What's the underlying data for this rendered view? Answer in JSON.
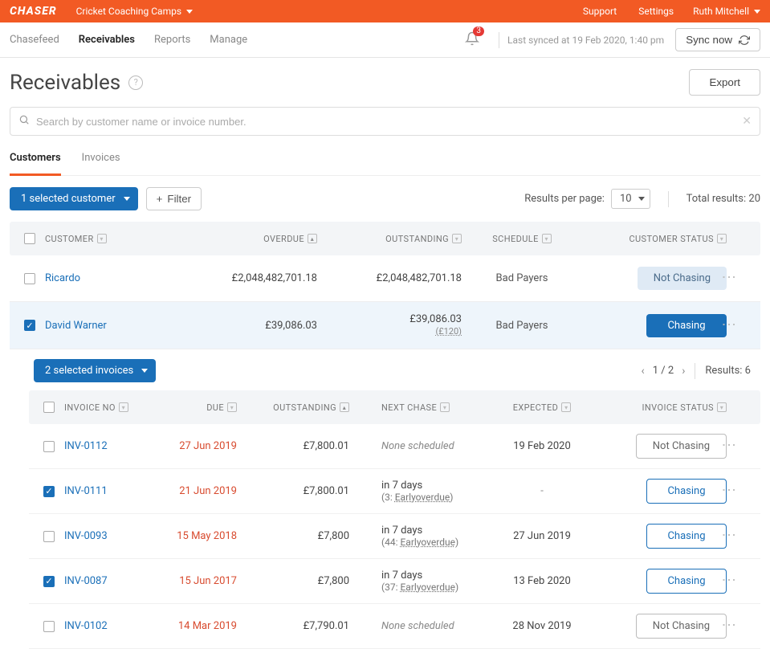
{
  "topbar": {
    "logo": "CHASER",
    "org": "Cricket Coaching Camps",
    "support": "Support",
    "settings": "Settings",
    "user": "Ruth Mitchell"
  },
  "nav": {
    "tabs": [
      "Chasefeed",
      "Receivables",
      "Reports",
      "Manage"
    ],
    "active": 1,
    "notif_count": "3",
    "last_synced": "Last synced at 19 Feb 2020, 1:40 pm",
    "sync_btn": "Sync now"
  },
  "page": {
    "title": "Receivables",
    "export": "Export",
    "search_placeholder": "Search by customer name or invoice number."
  },
  "subtabs": {
    "customers": "Customers",
    "invoices": "Invoices",
    "active": "customers"
  },
  "toolbar": {
    "selection": "1 selected customer",
    "filter": "Filter",
    "rpp_label": "Results per page:",
    "rpp_value": "10",
    "total_label": "Total results: 20"
  },
  "thead": {
    "customer": "CUSTOMER",
    "overdue": "OVERDUE",
    "outstanding": "OUTSTANDING",
    "schedule": "SCHEDULE",
    "status": "CUSTOMER STATUS"
  },
  "customers": [
    {
      "checked": false,
      "name": "Ricardo",
      "overdue": "£2,048,482,701.18",
      "outstanding": "£2,048,482,701.18",
      "credit": "",
      "schedule": "Bad Payers",
      "status": "Not Chasing",
      "status_style": "chip-notchasing-soft"
    },
    {
      "checked": true,
      "name": "David Warner",
      "overdue": "£39,086.03",
      "outstanding": "£39,086.03",
      "credit": "(£120)",
      "schedule": "Bad Payers",
      "status": "Chasing",
      "status_style": "chip-chasing-primary"
    }
  ],
  "inv_toolbar": {
    "selection": "2 selected invoices",
    "page": "1 / 2",
    "results": "Results: 6"
  },
  "ihead": {
    "no": "INVOICE NO",
    "due": "DUE",
    "outstanding": "OUTSTANDING",
    "next": "NEXT CHASE",
    "expected": "EXPECTED",
    "status": "INVOICE STATUS"
  },
  "invoices": [
    {
      "checked": false,
      "no": "INV-0112",
      "due": "27 Jun 2019",
      "outstanding": "£7,800.01",
      "next_chase": "None scheduled",
      "next_chase_style": "italic",
      "next_sub": "",
      "expected": "19 Feb 2020",
      "status": "Not Chasing",
      "status_style": "chip-notchasing-outline"
    },
    {
      "checked": true,
      "no": "INV-0111",
      "due": "21 Jun 2019",
      "outstanding": "£7,800.01",
      "next_chase": "in 7 days",
      "next_chase_style": "",
      "next_sub": "(3: Earlyoverdue)",
      "expected": "-",
      "status": "Chasing",
      "status_style": "chip-chasing-outline"
    },
    {
      "checked": false,
      "no": "INV-0093",
      "due": "15 May 2018",
      "outstanding": "£7,800",
      "next_chase": "in 7 days",
      "next_chase_style": "",
      "next_sub": "(44: Earlyoverdue)",
      "expected": "27 Jun 2019",
      "status": "Chasing",
      "status_style": "chip-chasing-outline"
    },
    {
      "checked": true,
      "no": "INV-0087",
      "due": "15 Jun 2017",
      "outstanding": "£7,800",
      "next_chase": "in 7 days",
      "next_chase_style": "",
      "next_sub": "(37: Earlyoverdue)",
      "expected": "13 Feb 2020",
      "status": "Chasing",
      "status_style": "chip-chasing-outline"
    },
    {
      "checked": false,
      "no": "INV-0102",
      "due": "14 Mar 2019",
      "outstanding": "£7,790.01",
      "next_chase": "None scheduled",
      "next_chase_style": "italic",
      "next_sub": "",
      "expected": "28 Nov 2019",
      "status": "Not Chasing",
      "status_style": "chip-notchasing-outline"
    }
  ]
}
